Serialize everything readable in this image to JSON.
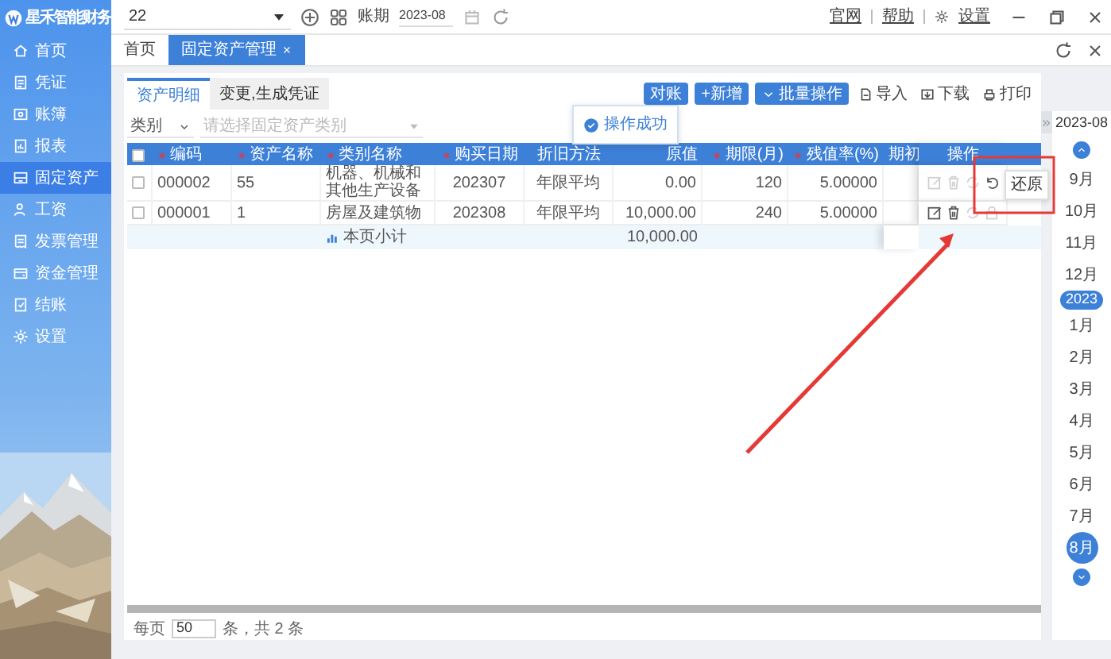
{
  "app": {
    "logo_text": "星禾智能财务"
  },
  "sidebar": {
    "items": [
      {
        "label": "首页",
        "selected": false
      },
      {
        "label": "凭证",
        "selected": false
      },
      {
        "label": "账簿",
        "selected": false
      },
      {
        "label": "报表",
        "selected": false
      },
      {
        "label": "固定资产",
        "selected": true
      },
      {
        "label": "工资",
        "selected": false
      },
      {
        "label": "发票管理",
        "selected": false
      },
      {
        "label": "资金管理",
        "selected": false
      },
      {
        "label": "结账",
        "selected": false
      },
      {
        "label": "设置",
        "selected": false
      }
    ]
  },
  "topbar": {
    "company": "22",
    "period_label": "账期",
    "period": "2023-08",
    "links": [
      "官网",
      "帮助",
      "设置"
    ]
  },
  "page_tabs": [
    {
      "label": "首页",
      "selected": false,
      "closable": false
    },
    {
      "label": "固定资产管理",
      "selected": true,
      "closable": true
    }
  ],
  "sub_tabs": [
    {
      "label": "资产明细",
      "selected": true
    },
    {
      "label": "变更,生成凭证",
      "selected": false
    }
  ],
  "toolbar": {
    "buttons": [
      {
        "label": "对账",
        "kind": "primary"
      },
      {
        "label": "+新增",
        "kind": "primary"
      },
      {
        "label": "批量操作",
        "kind": "dropdown"
      },
      {
        "label": "导入",
        "kind": "link"
      },
      {
        "label": "下载",
        "kind": "link"
      },
      {
        "label": "打印",
        "kind": "link"
      }
    ]
  },
  "filter": {
    "category": "类别",
    "type_placeholder": "请选择固定资产类别"
  },
  "table": {
    "select_all_checked": false,
    "columns": [
      {
        "label": "编码",
        "required": true
      },
      {
        "label": "资产名称",
        "required": true
      },
      {
        "label": "类别名称",
        "required": true
      },
      {
        "label": "购买日期",
        "required": true
      },
      {
        "label": "折旧方法",
        "required": false
      },
      {
        "label": "原值",
        "required": false
      },
      {
        "label": "期限(月)",
        "required": true
      },
      {
        "label": "残值率(%)",
        "required": true
      },
      {
        "label": "期初",
        "required": false
      },
      {
        "label": "操作",
        "required": false
      }
    ],
    "rows": [
      {
        "checked": false,
        "cells": [
          "000002",
          "55",
          "机器、机械和其他生产设备",
          "202307",
          "年限平均",
          "0.00",
          "120",
          "5.00000"
        ],
        "actions": [
          {
            "kind": "edit",
            "disabled": true
          },
          {
            "kind": "delete",
            "disabled": true
          },
          {
            "kind": "refresh",
            "disabled": true
          },
          {
            "kind": "restore",
            "disabled": false
          }
        ]
      },
      {
        "checked": false,
        "cells": [
          "000001",
          "1",
          "房屋及建筑物",
          "202308",
          "年限平均",
          "10,000.00",
          "240",
          "5.00000"
        ],
        "actions": [
          {
            "kind": "edit",
            "disabled": false
          },
          {
            "kind": "delete",
            "disabled": false
          },
          {
            "kind": "refresh",
            "disabled": true
          },
          {
            "kind": "lock",
            "disabled": true
          }
        ]
      }
    ],
    "subtotal": {
      "label": "本页小计",
      "amount": "10,000.00"
    }
  },
  "toast": {
    "message": "操作成功"
  },
  "tooltip": {
    "text": "还原"
  },
  "pagination": {
    "per_page_label": "每页",
    "per_page": "50",
    "total": "条，共 2 条"
  },
  "month_strip": {
    "current": "2023-08",
    "items": [
      {
        "label": "9月",
        "kind": "month",
        "selected": false
      },
      {
        "label": "10月",
        "kind": "month",
        "selected": false
      },
      {
        "label": "11月",
        "kind": "month",
        "selected": false
      },
      {
        "label": "12月",
        "kind": "month",
        "selected": false
      },
      {
        "label": "2023",
        "kind": "year"
      },
      {
        "label": "1月",
        "kind": "month",
        "selected": false
      },
      {
        "label": "2月",
        "kind": "month",
        "selected": false
      },
      {
        "label": "3月",
        "kind": "month",
        "selected": false
      },
      {
        "label": "4月",
        "kind": "month",
        "selected": false
      },
      {
        "label": "5月",
        "kind": "month",
        "selected": false
      },
      {
        "label": "6月",
        "kind": "month",
        "selected": false
      },
      {
        "label": "7月",
        "kind": "month",
        "selected": false
      },
      {
        "label": "8月",
        "kind": "month",
        "selected": true
      }
    ]
  }
}
